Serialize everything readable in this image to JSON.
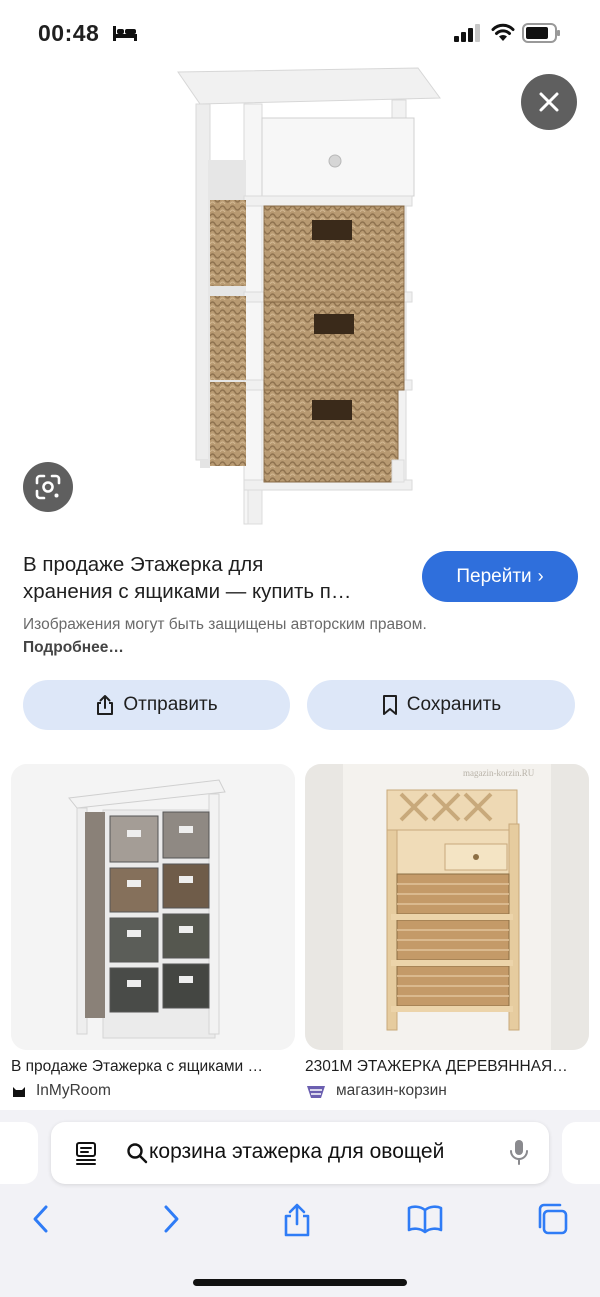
{
  "status_bar": {
    "time": "00:48"
  },
  "result": {
    "title_line1": "В продаже Этажерка для",
    "title_line2": "хранения с ящиками — купить п…",
    "visit_button": "Перейти",
    "copyright_text": "Изображения могут быть защищены авторским правом.",
    "more_link": "Подробнее…"
  },
  "actions": {
    "share_label": "Отправить",
    "save_label": "Сохранить"
  },
  "related": [
    {
      "title": "В продаже Этажерка с ящиками …",
      "source": "InMyRoom"
    },
    {
      "title": "2301М ЭТАЖЕРКА ДЕРЕВЯННАЯ…",
      "source": "магазин-корзин",
      "watermark": "magazin-korzin.RU"
    }
  ],
  "search": {
    "query": "корзина этажерка для овощей"
  },
  "toolbar": {
    "icons": [
      "back-icon",
      "forward-icon",
      "share-icon",
      "bookmarks-icon",
      "tabs-icon"
    ]
  },
  "colors": {
    "accent": "#2f6fdc",
    "pill_bg": "#dde7f8",
    "overlay_btn": "#5f5f5f"
  }
}
